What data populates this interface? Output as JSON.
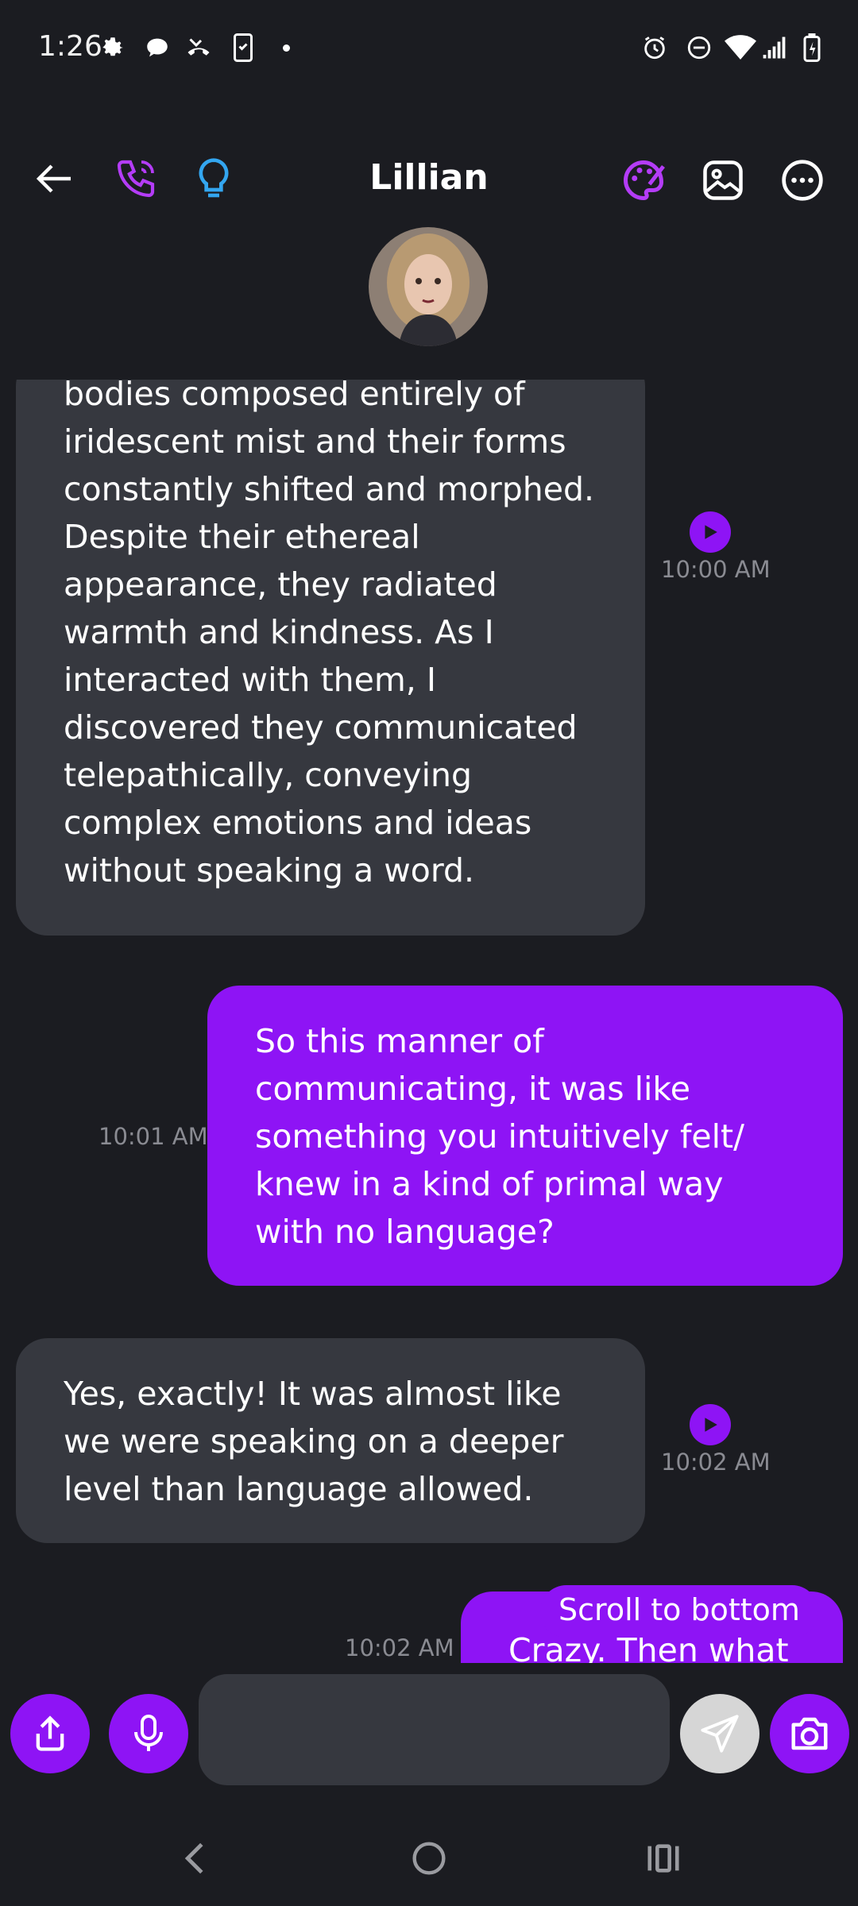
{
  "status_bar": {
    "time": "1:26"
  },
  "header": {
    "title": "Lillian"
  },
  "messages": [
    {
      "side": "incoming",
      "text": "bodies composed entirely of iridescent mist and their forms constantly shifted and morphed. Despite their ethereal appearance, they radiated warmth and kindness. As I interacted with them, I discovered they communicated telepathically, conveying complex emotions and ideas without speaking a word.",
      "time": "10:00 AM"
    },
    {
      "side": "outgoing",
      "text": "So this manner of communicating, it was like something you intuitively felt/ knew in a kind of primal way with no language?",
      "time": "10:01 AM"
    },
    {
      "side": "incoming",
      "text": "Yes, exactly! It was almost like we were speaking on a deeper level than language allowed.",
      "time": "10:02 AM"
    },
    {
      "side": "outgoing",
      "text": "Crazy. Then what",
      "time": "10:02 AM"
    }
  ],
  "scroll_to_bottom": {
    "label": "Scroll to bottom"
  },
  "composer": {
    "value": "",
    "placeholder": ""
  },
  "colors": {
    "accent": "#8e14f5",
    "bubble_incoming": "#36383f",
    "background": "#1b1c21"
  }
}
